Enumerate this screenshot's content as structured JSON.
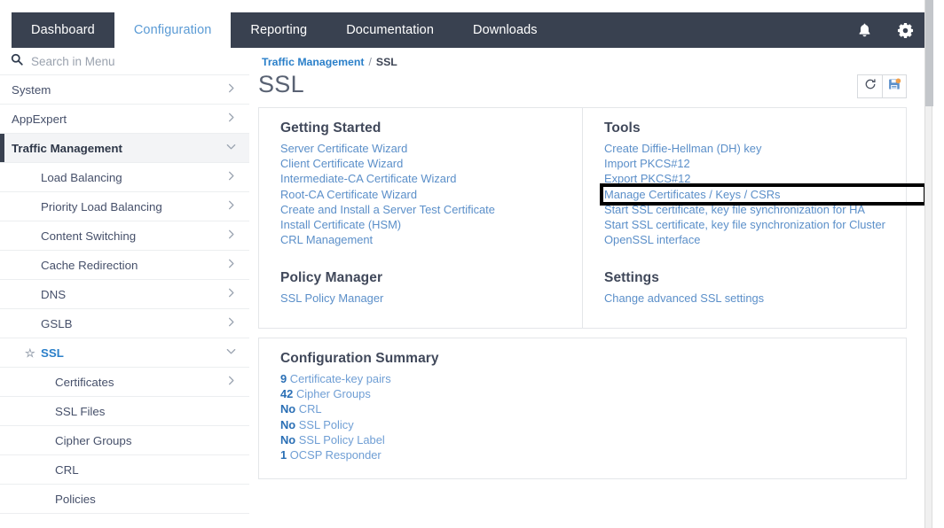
{
  "topnav": {
    "tabs": [
      {
        "label": "Dashboard",
        "active": false
      },
      {
        "label": "Configuration",
        "active": true
      },
      {
        "label": "Reporting",
        "active": false
      },
      {
        "label": "Documentation",
        "active": false
      },
      {
        "label": "Downloads",
        "active": false
      }
    ],
    "bell_icon": "bell-icon",
    "gear_icon": "gear-icon"
  },
  "sidebar": {
    "search_placeholder": "Search in Menu",
    "search_value": "",
    "search_icon": "search-icon",
    "items": [
      {
        "label": "System",
        "level": 1,
        "chevron": "right",
        "state": "normal"
      },
      {
        "label": "AppExpert",
        "level": 1,
        "chevron": "right",
        "state": "normal"
      },
      {
        "label": "Traffic Management",
        "level": 1,
        "chevron": "down",
        "state": "selected"
      },
      {
        "label": "Load Balancing",
        "level": 2,
        "chevron": "right",
        "state": "normal"
      },
      {
        "label": "Priority Load Balancing",
        "level": 2,
        "chevron": "right",
        "state": "normal"
      },
      {
        "label": "Content Switching",
        "level": 2,
        "chevron": "right",
        "state": "normal"
      },
      {
        "label": "Cache Redirection",
        "level": 2,
        "chevron": "right",
        "state": "normal"
      },
      {
        "label": "DNS",
        "level": 2,
        "chevron": "right",
        "state": "normal"
      },
      {
        "label": "GSLB",
        "level": 2,
        "chevron": "right",
        "state": "normal"
      },
      {
        "label": "SSL",
        "level": 2,
        "chevron": "down",
        "state": "active",
        "star": "☆"
      },
      {
        "label": "Certificates",
        "level": 3,
        "chevron": "right",
        "state": "normal"
      },
      {
        "label": "SSL Files",
        "level": 3,
        "chevron": "none",
        "state": "normal"
      },
      {
        "label": "Cipher Groups",
        "level": 3,
        "chevron": "none",
        "state": "normal"
      },
      {
        "label": "CRL",
        "level": 3,
        "chevron": "none",
        "state": "normal"
      },
      {
        "label": "Policies",
        "level": 3,
        "chevron": "none",
        "state": "normal"
      }
    ]
  },
  "breadcrumb": {
    "parent": "Traffic Management",
    "separator": "/",
    "current": "SSL"
  },
  "page": {
    "title": "SSL",
    "refresh_icon": "refresh-icon",
    "save_icon": "save-icon"
  },
  "getting_started": {
    "title": "Getting Started",
    "links": [
      "Server Certificate Wizard",
      "Client Certificate Wizard",
      "Intermediate-CA Certificate Wizard",
      "Root-CA Certificate Wizard",
      "Create and Install a Server Test Certificate",
      "Install Certificate (HSM)",
      "CRL Management"
    ]
  },
  "policy_manager": {
    "title": "Policy Manager",
    "links": [
      "SSL Policy Manager"
    ]
  },
  "tools": {
    "title": "Tools",
    "links": [
      "Create Diffie-Hellman (DH) key",
      "Import PKCS#12",
      "Export PKCS#12",
      "Manage Certificates / Keys / CSRs",
      "Start SSL certificate, key file synchronization for HA",
      "Start SSL certificate, key file synchronization for Cluster",
      "OpenSSL interface"
    ],
    "highlighted_link": "Manage Certificates / Keys / CSRs"
  },
  "settings": {
    "title": "Settings",
    "links": [
      "Change advanced SSL settings"
    ]
  },
  "configuration_summary": {
    "title": "Configuration Summary",
    "rows": [
      {
        "count": "9",
        "label": "Certificate-key pairs"
      },
      {
        "count": "42",
        "label": "Cipher Groups"
      },
      {
        "count": "No",
        "label": "CRL"
      },
      {
        "count": "No",
        "label": "SSL Policy"
      },
      {
        "count": "No",
        "label": "SSL Policy Label"
      },
      {
        "count": "1",
        "label": "OCSP Responder"
      }
    ]
  },
  "colors": {
    "navbar": "#394150",
    "link": "#5b8fc9",
    "accent": "#2a7fc9",
    "highlight_box": "#000000",
    "save_badge": "#f0a04b"
  }
}
